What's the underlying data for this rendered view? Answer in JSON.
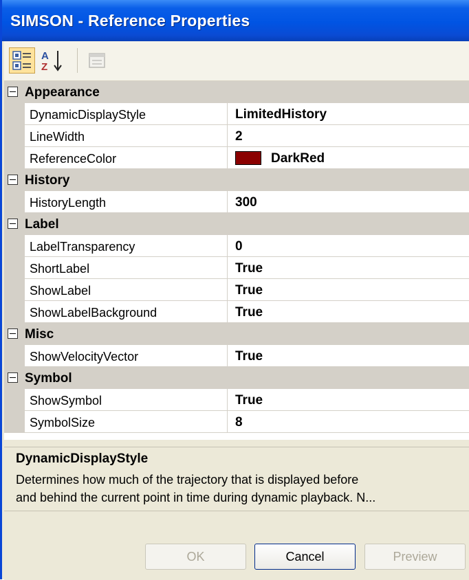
{
  "window": {
    "title": "SIMSON - Reference Properties"
  },
  "toolbar": {
    "categorized_icon": "categorized-icon",
    "alphabetical_icon": "alphabetical-sort-icon",
    "property_pages_icon": "property-pages-icon"
  },
  "grid": {
    "categories": [
      {
        "name": "Appearance"
      },
      {
        "name": "History"
      },
      {
        "name": "Label"
      },
      {
        "name": "Misc"
      },
      {
        "name": "Symbol"
      }
    ],
    "properties": {
      "dynamic_display_style": {
        "name": "DynamicDisplayStyle",
        "value": "LimitedHistory"
      },
      "line_width": {
        "name": "LineWidth",
        "value": "2"
      },
      "reference_color": {
        "name": "ReferenceColor",
        "value": "DarkRed",
        "swatch": "#8b0000"
      },
      "history_length": {
        "name": "HistoryLength",
        "value": "300"
      },
      "label_transparency": {
        "name": "LabelTransparency",
        "value": "0"
      },
      "short_label": {
        "name": "ShortLabel",
        "value": "True"
      },
      "show_label": {
        "name": "ShowLabel",
        "value": "True"
      },
      "show_label_background": {
        "name": "ShowLabelBackground",
        "value": "True"
      },
      "show_velocity_vector": {
        "name": "ShowVelocityVector",
        "value": "True"
      },
      "show_symbol": {
        "name": "ShowSymbol",
        "value": "True"
      },
      "symbol_size": {
        "name": "SymbolSize",
        "value": "8"
      }
    }
  },
  "description": {
    "title": "DynamicDisplayStyle",
    "line1": "Determines how much of the trajectory that is displayed before",
    "line2": "and behind the current point in time during dynamic playback. N..."
  },
  "buttons": {
    "ok": "OK",
    "cancel": "Cancel",
    "preview": "Preview"
  },
  "colors": {
    "title_bar": "#0054e3",
    "category_row": "#d4d0c8",
    "window_face": "#ece9d8"
  }
}
